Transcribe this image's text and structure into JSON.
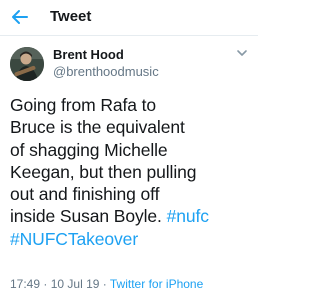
{
  "header": {
    "title": "Tweet",
    "back_icon": "back-arrow-icon",
    "accent_color": "#1da1f2"
  },
  "tweet": {
    "author_name": "Brent Hood",
    "author_handle": "@brenthoodmusic",
    "more_icon": "chevron-down-icon",
    "text_lines": [
      "Going from Rafa to",
      "Bruce is the equivalent",
      "of shagging Michelle",
      "Keegan, but then pulling",
      "out and finishing off",
      "inside Susan Boyle."
    ],
    "hashtags": [
      "#nufc",
      "#NUFCTakeover"
    ],
    "time": "17:49",
    "separator": "·",
    "date": "10 Jul 19",
    "source": "Twitter for iPhone"
  }
}
